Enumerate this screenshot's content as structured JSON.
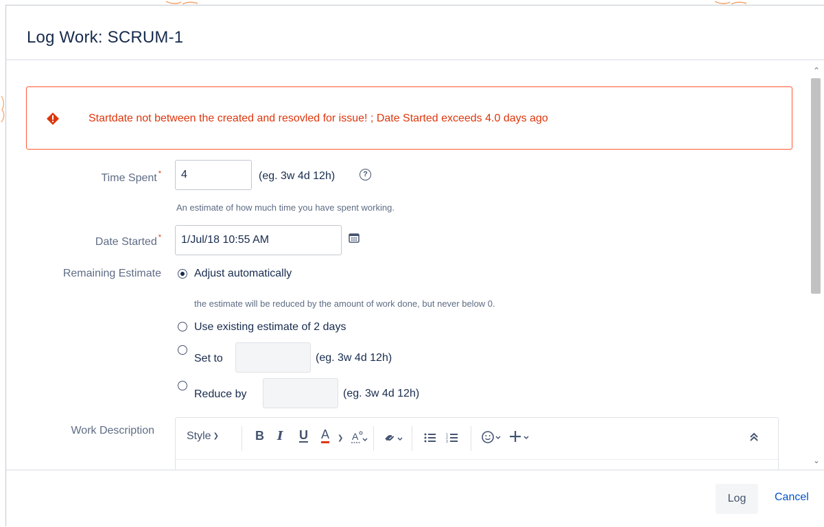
{
  "dialog": {
    "title": "Log Work: SCRUM-1"
  },
  "error": {
    "message": "Startdate not between the created and resovled for issue! ; Date Started exceeds 4.0 days ago",
    "color": "#de350b"
  },
  "form": {
    "time_spent": {
      "label": "Time Spent",
      "required_mark": "*",
      "value": "4",
      "hint": "(eg. 3w 4d 12h)",
      "description": "An estimate of how much time you have spent working."
    },
    "date_started": {
      "label": "Date Started",
      "required_mark": "*",
      "value": "1/Jul/18 10:55 AM"
    },
    "remaining_estimate": {
      "label": "Remaining Estimate",
      "options": [
        {
          "label": "Adjust automatically",
          "checked": true,
          "description": "the estimate will be reduced by the amount of work done, but never below 0."
        },
        {
          "label": "Use existing estimate of 2 days",
          "checked": false
        },
        {
          "label": "Set to",
          "checked": false,
          "value": "",
          "hint": "(eg. 3w 4d 12h)"
        },
        {
          "label": "Reduce by",
          "checked": false,
          "value": "",
          "hint": "(eg. 3w 4d 12h)"
        }
      ]
    },
    "work_description": {
      "label": "Work Description",
      "toolbar": {
        "style_label": "Style",
        "bold": "B",
        "italic": "I",
        "underline": "U",
        "text_color": "A",
        "icons": [
          "chevron-down-icon",
          "text-format-icon",
          "link-icon",
          "bullet-list-icon",
          "numbered-list-icon",
          "emoji-icon",
          "insert-plus-icon",
          "collapse-icon"
        ]
      }
    }
  },
  "footer": {
    "log_label": "Log",
    "cancel_label": "Cancel"
  },
  "colors": {
    "accent": "#0052cc",
    "error_border": "#ff5630",
    "text": "#172b4d",
    "muted": "#5e6c84"
  }
}
